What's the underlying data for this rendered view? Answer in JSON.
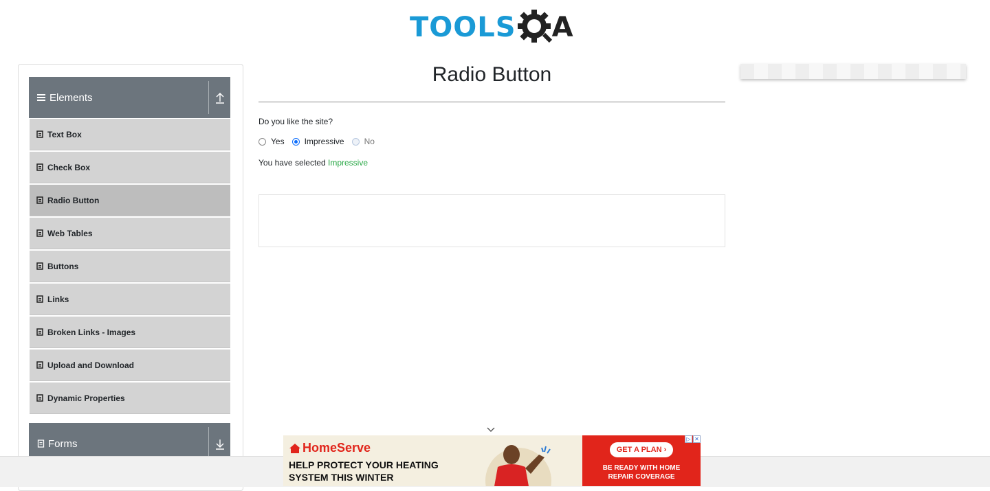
{
  "header": {
    "logo_text": "TOOLS",
    "logo_suffix": "A",
    "logo_alt": "TOOLSQA"
  },
  "sidebar": {
    "groups": [
      {
        "label": "Elements",
        "expanded": true
      },
      {
        "label": "Forms",
        "expanded": false
      }
    ],
    "items": [
      {
        "label": "Text Box"
      },
      {
        "label": "Check Box"
      },
      {
        "label": "Radio Button",
        "active": true
      },
      {
        "label": "Web Tables"
      },
      {
        "label": "Buttons"
      },
      {
        "label": "Links"
      },
      {
        "label": "Broken Links - Images"
      },
      {
        "label": "Upload and Download"
      },
      {
        "label": "Dynamic Properties"
      }
    ]
  },
  "main": {
    "title": "Radio Button",
    "question": "Do you like the site?",
    "options": [
      {
        "label": "Yes",
        "checked": false,
        "disabled": false
      },
      {
        "label": "Impressive",
        "checked": true,
        "disabled": false
      },
      {
        "label": "No",
        "checked": false,
        "disabled": true
      }
    ],
    "result_prefix": "You have selected",
    "result_value": "Impressive"
  },
  "ad": {
    "brand": "HomeServe",
    "headline": "HELP PROTECT YOUR HEATING SYSTEM THIS WINTER",
    "cta": "GET A PLAN ›",
    "subtext": "BE READY WITH HOME REPAIR COVERAGE"
  },
  "colors": {
    "accent": "#0d6efd",
    "success": "#28a745",
    "sidebar_header": "#6c757d",
    "brand_blue": "#1a9ad6",
    "ad_red": "#e1251b"
  }
}
